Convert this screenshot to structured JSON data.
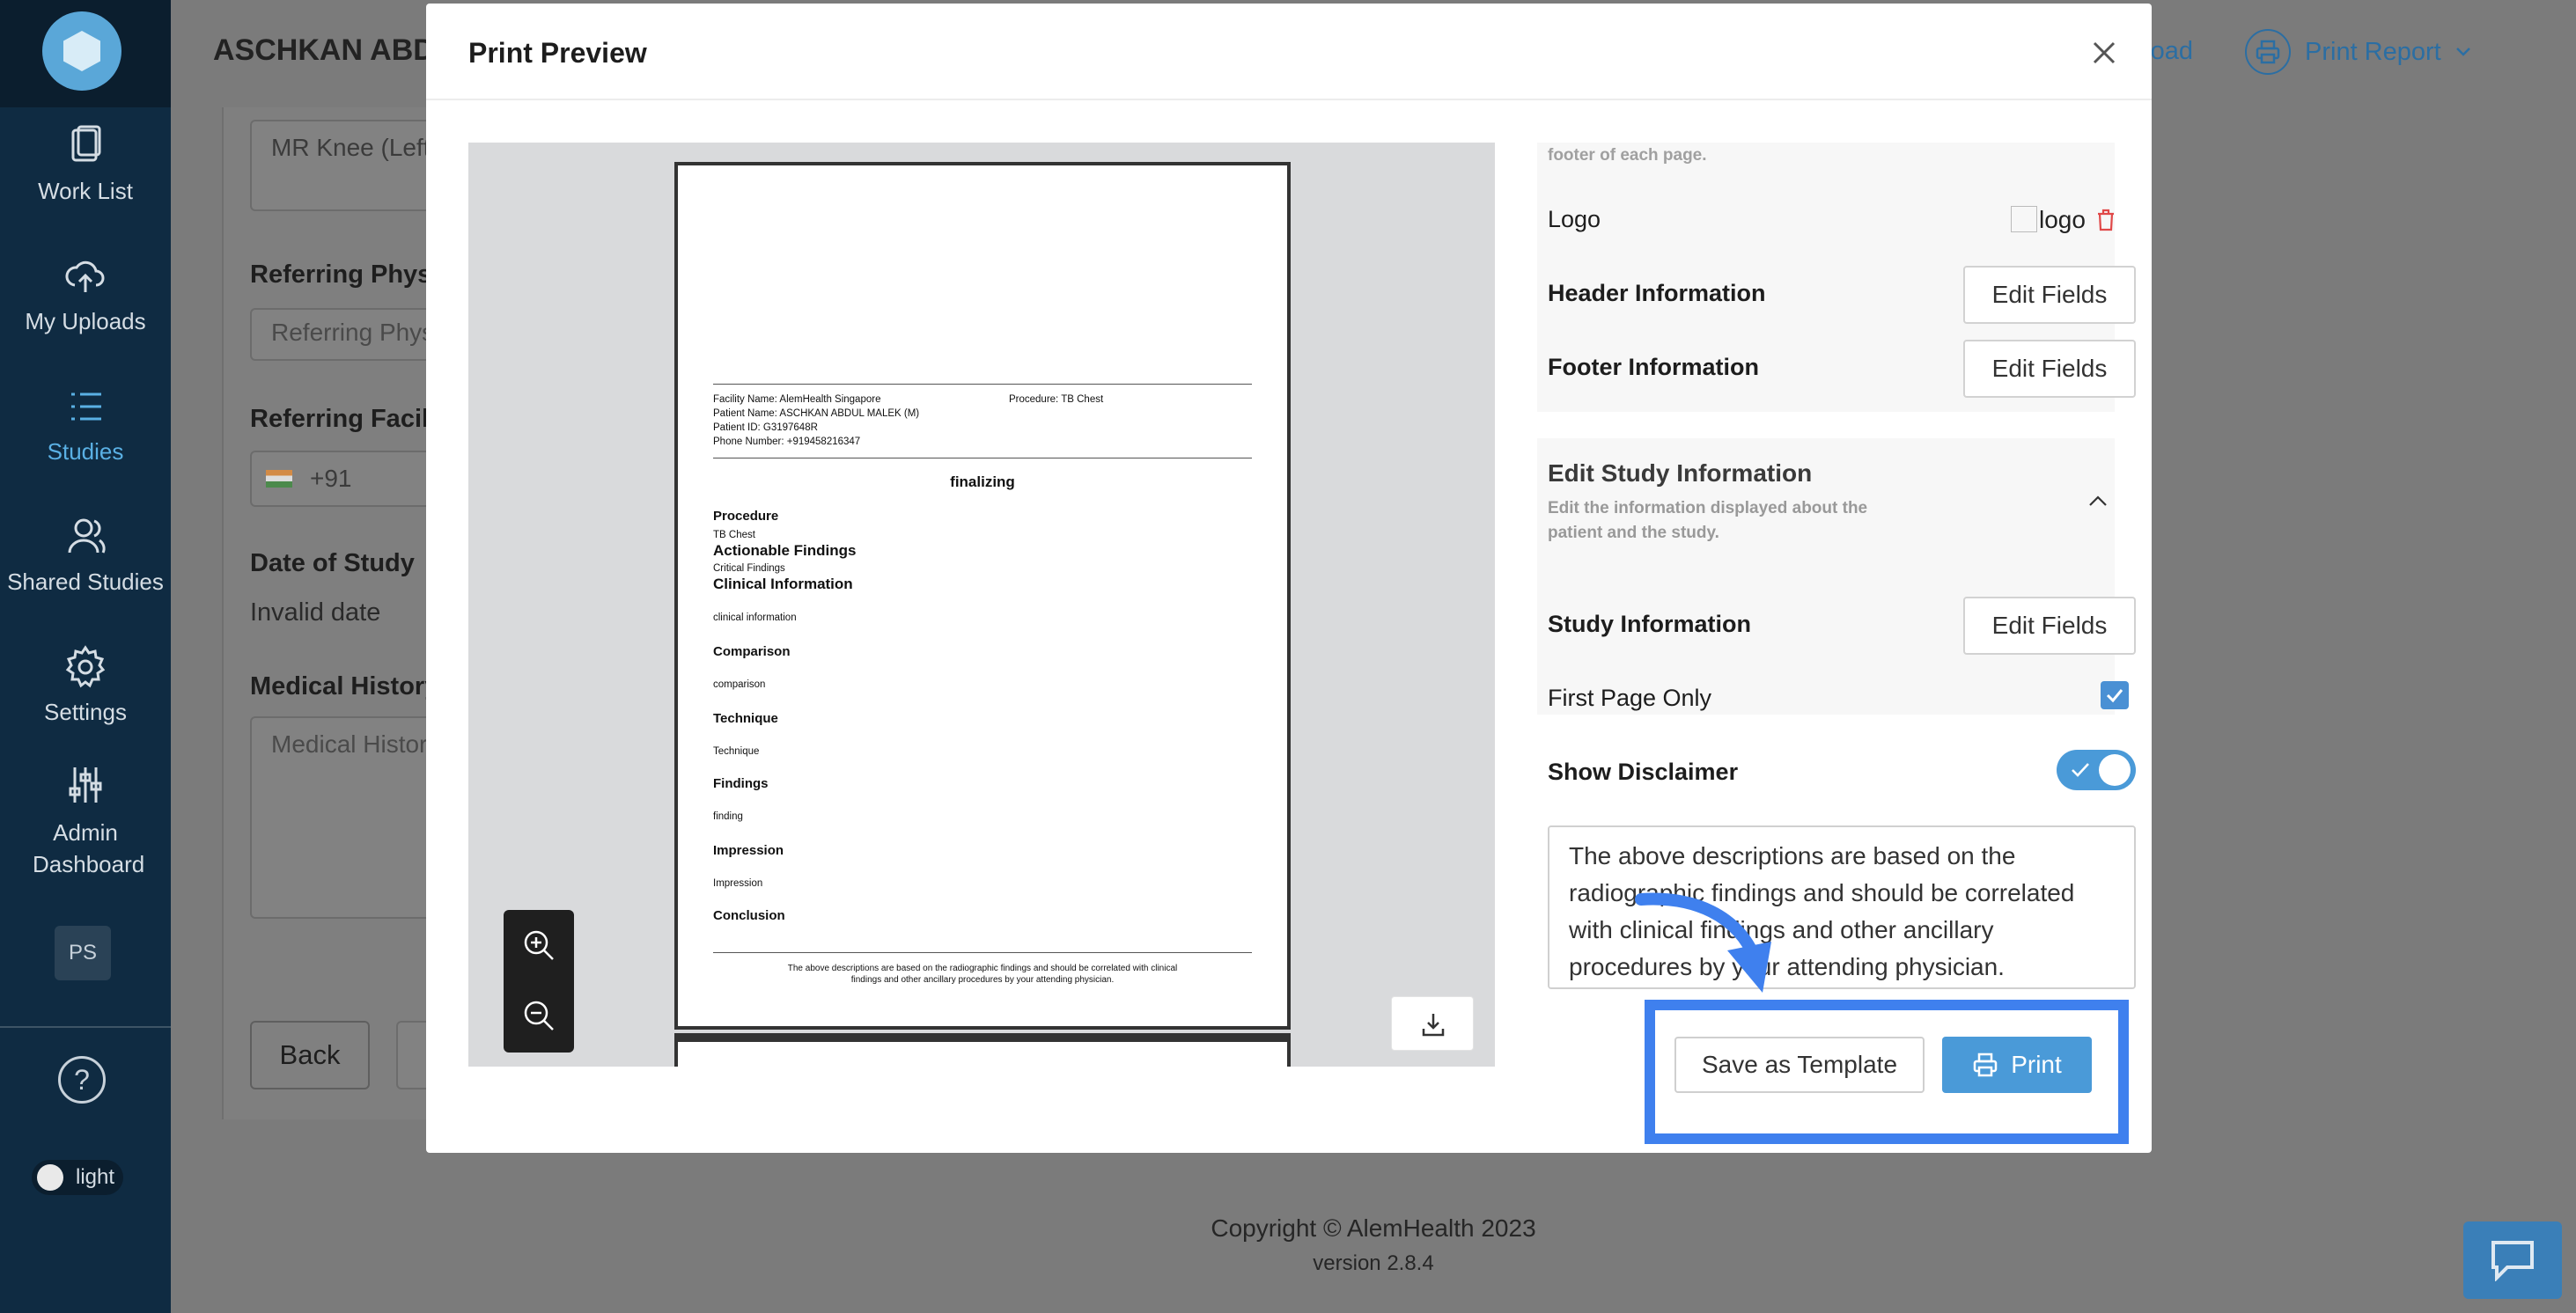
{
  "app": {
    "patient_name": "ASCHKAN ABDU",
    "download_label": "nload",
    "print_report_label": "Print Report"
  },
  "sidebar": {
    "items": [
      {
        "label": "Work List",
        "icon": "clipboard-icon"
      },
      {
        "label": "My Uploads",
        "icon": "cloud-upload-icon"
      },
      {
        "label": "Studies",
        "icon": "list-icon"
      },
      {
        "label": "Shared Studies",
        "icon": "users-icon"
      },
      {
        "label": "Settings",
        "icon": "gear-icon"
      },
      {
        "label": "Admin Dashboard",
        "icon": "sliders-icon"
      }
    ],
    "active": "Studies",
    "user_initials": "PS",
    "help_symbol": "?",
    "theme_label": "light"
  },
  "background_form": {
    "procedure_value": "MR Knee (Left",
    "referring_physician_label": "Referring Physi",
    "referring_physician_placeholder": "Referring Phys",
    "referring_facility_label": "Referring Facili",
    "phone_code": "+91",
    "date_of_study_label": "Date of Study",
    "date_of_study_value": "Invalid date",
    "medical_history_label": "Medical History",
    "medical_history_placeholder": "Medical Histor",
    "back_label": "Back"
  },
  "footer": {
    "copyright": "Copyright © AlemHealth 2023",
    "version": "version 2.8.4"
  },
  "modal": {
    "title": "Print Preview",
    "preview_page": {
      "facility": "Facility Name: AlemHealth Singapore",
      "procedure_header": "Procedure: TB Chest",
      "patient": "Patient Name: ASCHKAN ABDUL MALEK (M)",
      "patient_id": "Patient ID: G3197648R",
      "phone": "Phone Number: +919458216347",
      "status": "finalizing",
      "sections": [
        {
          "heading": "Procedure",
          "text": "TB Chest"
        },
        {
          "heading": "Actionable Findings",
          "text": "Critical Findings"
        },
        {
          "heading": "Clinical Information",
          "text": "clinical information"
        },
        {
          "heading": "Comparison",
          "text": "comparison"
        },
        {
          "heading": "Technique",
          "text": "Technique"
        },
        {
          "heading": "Findings",
          "text": "finding"
        },
        {
          "heading": "Impression",
          "text": "Impression"
        },
        {
          "heading": "Conclusion",
          "text": ""
        }
      ],
      "disclaimer": "The above descriptions are based on the radiographic findings and should be correlated with clinical findings and other ancillary procedures by your attending physician."
    },
    "settings": {
      "footer_note": "footer of each page.",
      "logo_label": "Logo",
      "logo_alt": "logo",
      "header_info_label": "Header Information",
      "footer_info_label": "Footer Information",
      "edit_fields_label": "Edit Fields",
      "edit_study_title": "Edit Study Information",
      "edit_study_sub": "Edit the information displayed about the patient and the study.",
      "study_info_label": "Study Information",
      "first_page_only_label": "First Page Only",
      "first_page_only_checked": true,
      "show_disclaimer_label": "Show Disclaimer",
      "show_disclaimer_on": true,
      "disclaimer_text": "The above descriptions are based on the radiographic findings and should be correlated with clinical findings and other ancillary procedures by your attending physician."
    },
    "save_template_label": "Save as Template",
    "print_label": "Print"
  },
  "colors": {
    "accent": "#4a9ad8",
    "highlight": "#3f80ee",
    "sidebar_bg": "#0f2b42",
    "danger": "#e04848"
  }
}
